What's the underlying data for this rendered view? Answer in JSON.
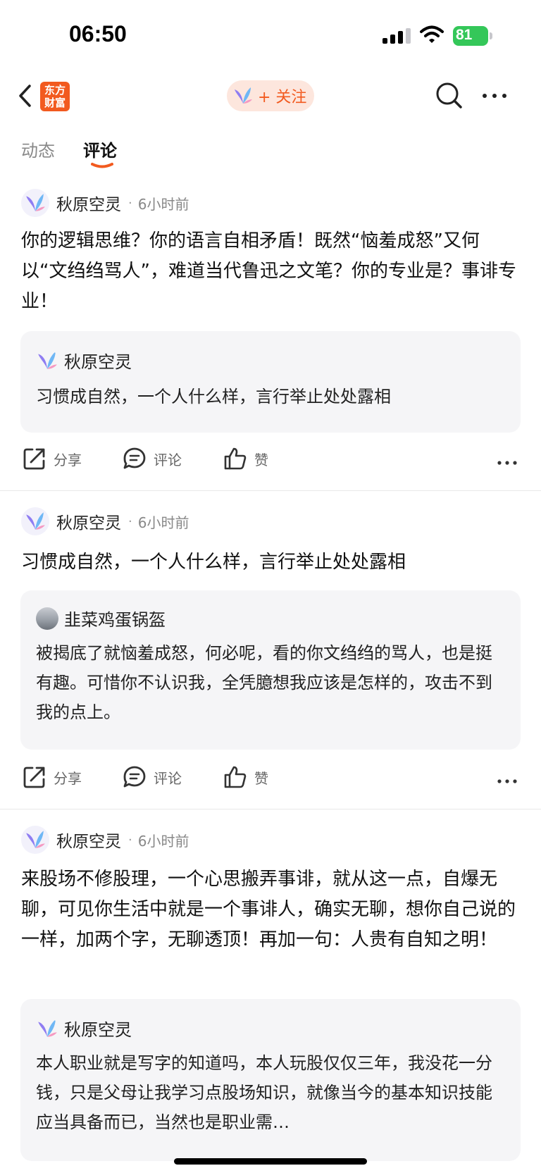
{
  "status_bar": {
    "time": "06:50",
    "battery": "81"
  },
  "header": {
    "logo_text": "东方财富",
    "follow_label": "+ 关注"
  },
  "tabs": {
    "news": "动态",
    "comments": "评论"
  },
  "actions": {
    "share": "分享",
    "comment": "评论",
    "like": "赞"
  },
  "posts": [
    {
      "user": "秋原空灵",
      "time": "6小时前",
      "content": "你的逻辑思维？你的语言自相矛盾！既然“恼羞成怒”又何以“文绉绉骂人”，难道当代鲁迅之文笔？你的专业是？事诽专业！",
      "quote": {
        "user": "秋原空灵",
        "text": "习惯成自然，一个人什么样，言行举止处处露相"
      }
    },
    {
      "user": "秋原空灵",
      "time": "6小时前",
      "content": "习惯成自然，一个人什么样，言行举止处处露相",
      "quote": {
        "user": "韭菜鸡蛋锅盔",
        "text": "被揭底了就恼羞成怒，何必呢，看的你文绉绉的骂人，也是挺有趣。可惜你不认识我，全凭臆想我应该是怎样的，攻击不到我的点上。"
      }
    },
    {
      "user": "秋原空灵",
      "time": "6小时前",
      "content": "来股场不修股理，一个心思搬弄事诽，就从这一点，自爆无聊，可见你生活中就是一个事诽人，确实无聊，想你自己说的一样，加两个字，无聊透顶！再加一句：人贵有自知之明！",
      "quote": {
        "user": "秋原空灵",
        "text": "本人职业就是写字的知道吗，本人玩股仅仅三年，我没花一分钱，只是父母让我学习点股场知识，就像当今的基本知识技能应当具备而已，当然也是职业需…"
      }
    }
  ],
  "colors": {
    "accent": "#f25a1f",
    "battery": "#34c759",
    "quote_bg": "#f5f5f7"
  }
}
